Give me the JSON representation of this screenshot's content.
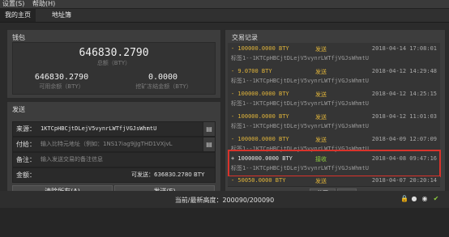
{
  "menu": {
    "settings": "设置(S)",
    "help": "帮助(H)"
  },
  "tabs": [
    {
      "label": "我的主页"
    },
    {
      "label": "地址簿"
    }
  ],
  "wallet": {
    "title": "钱包",
    "total": "646830.2790",
    "total_label": "总额（BTY）",
    "available": "646830.2790",
    "available_label": "可用余额（BTY）",
    "mining": "0.0000",
    "mining_label": "挖矿冻结金额（BTY）"
  },
  "send": {
    "title": "发送",
    "source_label": "来源：",
    "source_value": "1KTCpHBCjtDLejV5vynrLWTfjVGJsWhmtU",
    "pay_label": "付给：",
    "pay_placeholder": "输入比特元地址（例如：1NS17iag9jJgTHD1VXjvL",
    "note_label": "备注：",
    "note_placeholder": "输入发送交易的备注信息",
    "amount_label": "金额：",
    "available_text": "可发送：636830.2780 BTY",
    "clear_button": "清除所有(A)",
    "send_button": "发送(E)"
  },
  "transactions": {
    "title": "交易记录",
    "items": [
      {
        "amount": "- 100000.0000 BTY",
        "type": "发送",
        "date": "2018-04-14 17:08:01",
        "addr": "标签1--1KTCpHBCjtDLejV5vynrLWTfjVGJsWhmtU"
      },
      {
        "amount": "- 9.0700 BTY",
        "type": "发送",
        "date": "2018-04-12 14:29:48",
        "addr": "标签1--1KTCpHBCjtDLejV5vynrLWTfjVGJsWhmtU"
      },
      {
        "amount": "- 100000.0000 BTY",
        "type": "发送",
        "date": "2018-04-12 14:25:15",
        "addr": "标签1--1KTCpHBCjtDLejV5vynrLWTfjVGJsWhmtU"
      },
      {
        "amount": "- 100000.0000 BTY",
        "type": "发送",
        "date": "2018-04-12 11:01:03",
        "addr": "标签1--1KTCpHBCjtDLejV5vynrLWTfjVGJsWhmtU"
      },
      {
        "amount": "- 100000.0000 BTY",
        "type": "发送",
        "date": "2018-04-09 12:07:09",
        "addr": "标签1--1KTCpHBCjtDLejV5vynrLWTfjVGJsWhmtU"
      },
      {
        "amount": "+ 1000000.0000 BTY",
        "type": "接收",
        "date": "2018-04-08 09:47:16",
        "addr": "标签1--1KTCpHBCjtDLejV5vynrLWTfjVGJsWhmtU"
      },
      {
        "amount": "- 50050.0000 BTY",
        "type": "发送",
        "date": "2018-04-07 20:20:14",
        "addr": ""
      }
    ],
    "first_page": "首页",
    "next_page": "›"
  },
  "status": {
    "text": "当前/最新高度：200090/200090"
  },
  "colors": {
    "send": "#e0b43a",
    "receive": "#8fce3f",
    "highlight": "#d9332b"
  },
  "icons": [
    "lock-icon",
    "network-icon",
    "sync-icon",
    "check-icon"
  ]
}
